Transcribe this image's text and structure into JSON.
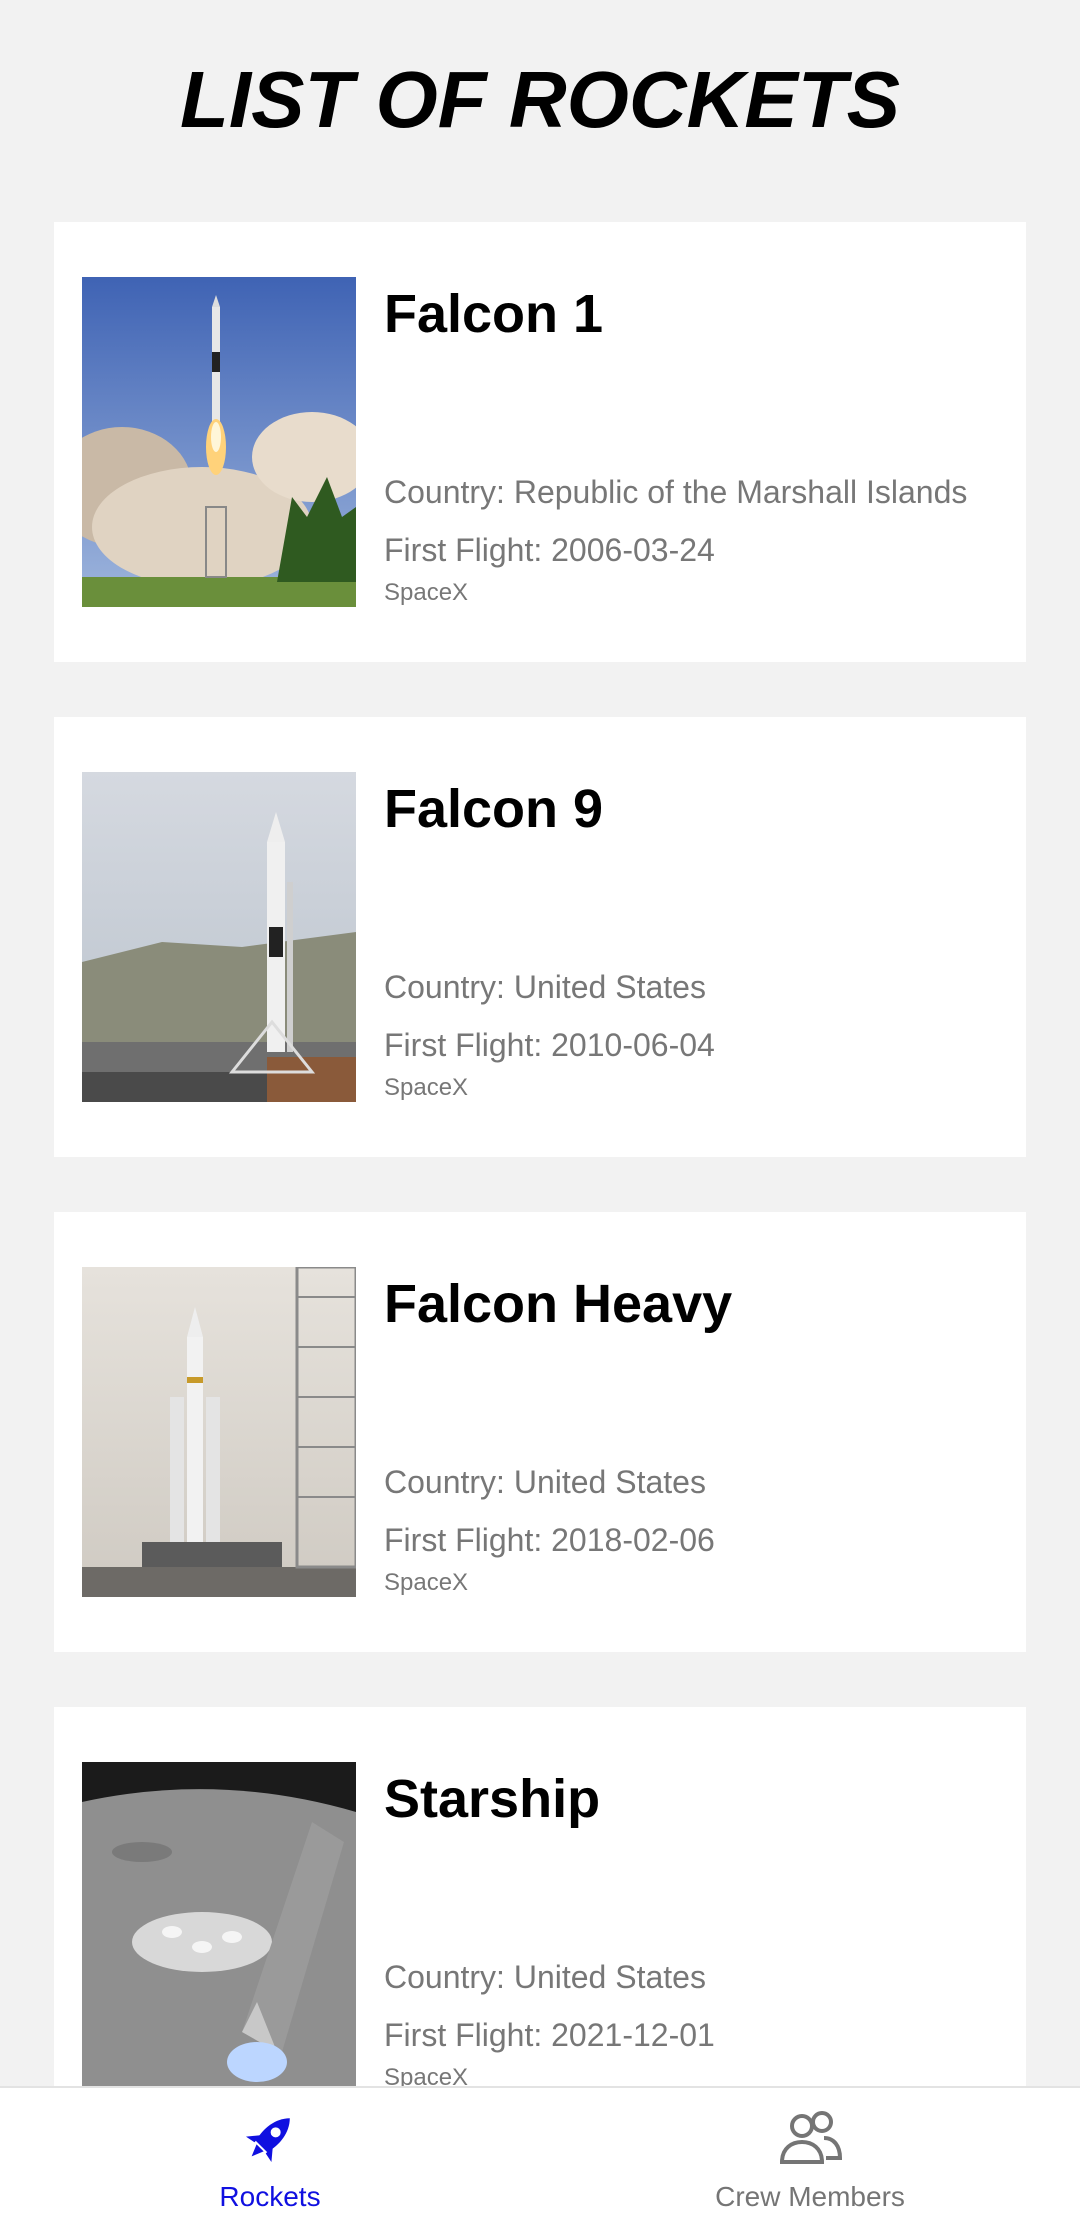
{
  "page": {
    "title": "LIST OF ROCKETS"
  },
  "labels": {
    "country_prefix": "Country: ",
    "first_flight_prefix": "First Flight: "
  },
  "rockets": [
    {
      "name": "Falcon 1",
      "country": "Republic of the Marshall Islands",
      "first_flight": "2006-03-24",
      "company": "SpaceX",
      "image": "falcon-1-launch-photo"
    },
    {
      "name": "Falcon 9",
      "country": "United States",
      "first_flight": "2010-06-04",
      "company": "SpaceX",
      "image": "falcon-9-pad-photo"
    },
    {
      "name": "Falcon Heavy",
      "country": "United States",
      "first_flight": "2018-02-06",
      "company": "SpaceX",
      "image": "falcon-heavy-pad-photo"
    },
    {
      "name": "Starship",
      "country": "United States",
      "first_flight": "2021-12-01",
      "company": "SpaceX",
      "image": "starship-moon-render"
    }
  ],
  "bottom_nav": {
    "items": [
      {
        "label": "Rockets",
        "icon": "rocket-icon",
        "active": true
      },
      {
        "label": "Crew Members",
        "icon": "people-icon",
        "active": false
      }
    ]
  },
  "colors": {
    "accent": "#1010e0",
    "inactive": "#757575",
    "background": "#f2f2f2"
  }
}
